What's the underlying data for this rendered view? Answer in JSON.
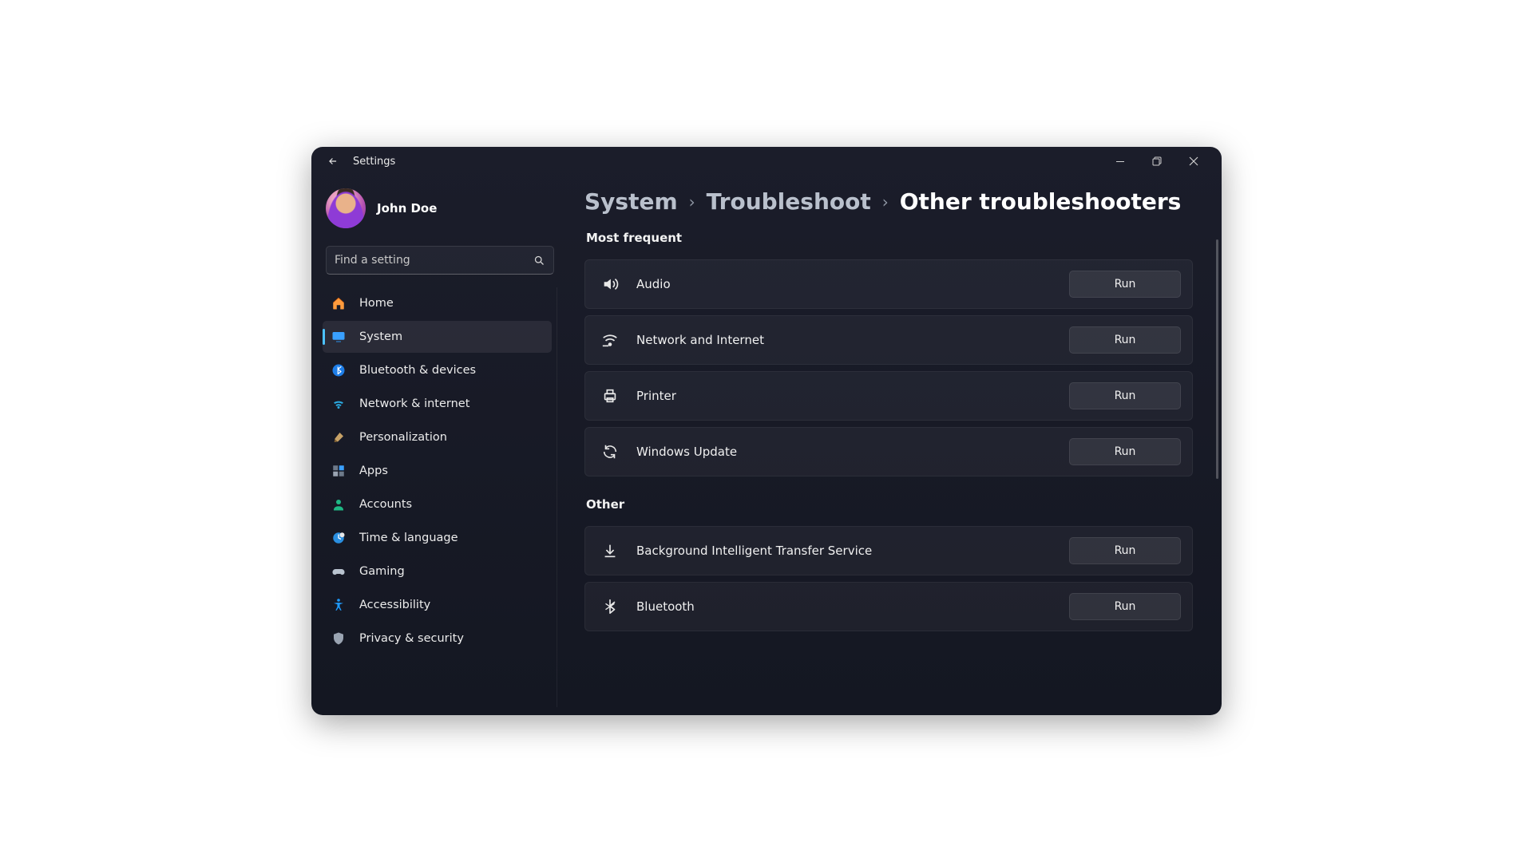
{
  "window": {
    "title": "Settings"
  },
  "user": {
    "name": "John Doe"
  },
  "search": {
    "placeholder": "Find a setting"
  },
  "sidebar": {
    "items": [
      {
        "label": "Home"
      },
      {
        "label": "System"
      },
      {
        "label": "Bluetooth & devices"
      },
      {
        "label": "Network & internet"
      },
      {
        "label": "Personalization"
      },
      {
        "label": "Apps"
      },
      {
        "label": "Accounts"
      },
      {
        "label": "Time & language"
      },
      {
        "label": "Gaming"
      },
      {
        "label": "Accessibility"
      },
      {
        "label": "Privacy & security"
      }
    ],
    "active_index": 1
  },
  "breadcrumb": {
    "level1": "System",
    "level2": "Troubleshoot",
    "level3": "Other troubleshooters"
  },
  "sections": {
    "most_frequent": {
      "title": "Most frequent",
      "items": [
        {
          "label": "Audio",
          "action": "Run"
        },
        {
          "label": "Network and Internet",
          "action": "Run"
        },
        {
          "label": "Printer",
          "action": "Run"
        },
        {
          "label": "Windows Update",
          "action": "Run"
        }
      ]
    },
    "other": {
      "title": "Other",
      "items": [
        {
          "label": "Background Intelligent Transfer Service",
          "action": "Run"
        },
        {
          "label": "Bluetooth",
          "action": "Run"
        }
      ]
    }
  }
}
